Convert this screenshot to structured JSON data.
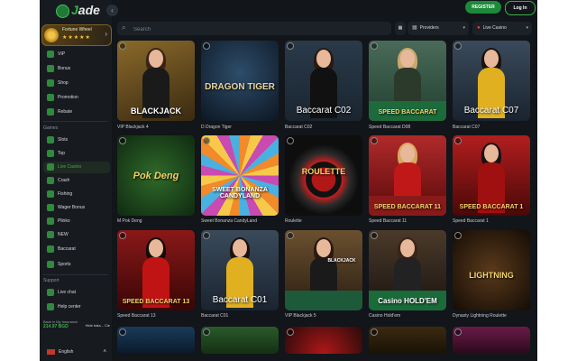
{
  "brand": {
    "logo_text": "Jade",
    "logo_first": "J",
    "logo_rest": "ade"
  },
  "header": {
    "register": "REGISTER",
    "login": "Log In"
  },
  "sidebar": {
    "fortune_wheel": {
      "title": "Fortune Wheel",
      "stars": "★★★★★"
    },
    "top_items": [
      {
        "label": "VIP"
      },
      {
        "label": "Bonus"
      },
      {
        "label": "Shop"
      },
      {
        "label": "Promotion"
      },
      {
        "label": "Rebate"
      }
    ],
    "games_heading": "Games",
    "game_items": [
      {
        "label": "Slots"
      },
      {
        "label": "Top"
      },
      {
        "label": "Live Casino"
      },
      {
        "label": "Crash"
      },
      {
        "label": "Fishing"
      },
      {
        "label": "Wager Bonus"
      },
      {
        "label": "Plinko"
      },
      {
        "label": "NEW"
      },
      {
        "label": "Baccarat"
      },
      {
        "label": "Sports"
      }
    ],
    "support_heading": "Support",
    "support_items": [
      {
        "label": "Live chat"
      },
      {
        "label": "Help center"
      }
    ],
    "promo": {
      "line1": "Back in My Insurance",
      "amount": "214.97 BGD",
      "button": "Hide bala... Cle"
    },
    "language": "English"
  },
  "search": {
    "placeholder": "Search"
  },
  "filters": {
    "providers": "Providers",
    "category": "Live Casino"
  },
  "games": [
    {
      "name": "VIP Blackjack 4",
      "overlay": "BLACKJACK"
    },
    {
      "name": "D Dragon Tiger",
      "overlay": "DRAGON TIGER"
    },
    {
      "name": "Baccarat C02",
      "overlay": "Baccarat C02"
    },
    {
      "name": "Speed Baccarat D08",
      "overlay": "SPEED BACCARAT"
    },
    {
      "name": "Baccarat C07",
      "overlay": "Baccarat C07"
    },
    {
      "name": "M Pok Deng",
      "overlay": "Pok Deng"
    },
    {
      "name": "Sweet Bonanza CandyLand",
      "overlay": "SWEET BONANZA CANDYLAND"
    },
    {
      "name": "Roulette",
      "overlay": "ROULETTE"
    },
    {
      "name": "Speed Baccarat 11",
      "overlay": "SPEED BACCARAT 11"
    },
    {
      "name": "Speed Baccarat 1",
      "overlay": "SPEED BACCARAT 1"
    },
    {
      "name": "Speed Baccarat 13",
      "overlay": "SPEED BACCARAT 13"
    },
    {
      "name": "Baccarat C01",
      "overlay": "Baccarat C01"
    },
    {
      "name": "VIP Blackjack 5",
      "overlay": "BLACKJACK"
    },
    {
      "name": "Casino Hold'em",
      "overlay": "Casino HOLD'EM"
    },
    {
      "name": "Dynasty Lightning Roulette",
      "overlay": "LIGHTNING"
    }
  ],
  "colors": {
    "accent": "#3bb04a",
    "background": "#121519",
    "sidebar": "#171b20"
  }
}
